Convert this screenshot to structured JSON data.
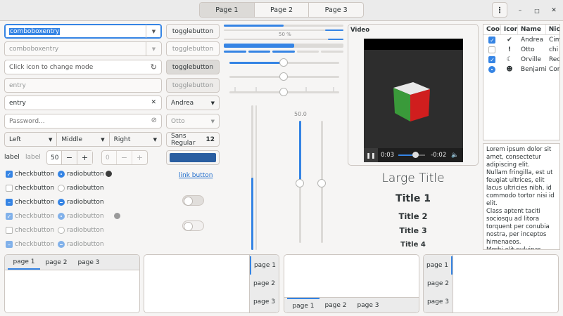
{
  "header": {
    "tabs": [
      "Page 1",
      "Page 2",
      "Page 3"
    ],
    "menu_icon": "⋮",
    "minimize_icon": "–",
    "maximize_icon": "□",
    "close_icon": "✕"
  },
  "col1": {
    "combo1": "comboboxentry",
    "combo2": "comboboxentry",
    "icon_entry": "Click icon to change mode",
    "entry_disabled": "entry",
    "entry_clear": "entry",
    "password_placeholder": "Password...",
    "segmented": [
      "Left",
      "Middle",
      "Right"
    ],
    "label1": "label",
    "label2": "label",
    "spin1": "50",
    "spin2": "0",
    "checks": [
      {
        "label": "checkbutton",
        "state": "on"
      },
      {
        "label": "checkbutton",
        "state": "off"
      },
      {
        "label": "checkbutton",
        "state": "mixed"
      },
      {
        "label": "checkbutton",
        "state": "on"
      },
      {
        "label": "checkbutton",
        "state": "off"
      },
      {
        "label": "checkbutton",
        "state": "mixed"
      }
    ],
    "radios": [
      {
        "label": "radiobutton",
        "state": "on"
      },
      {
        "label": "radiobutton",
        "state": "off"
      },
      {
        "label": "radiobutton",
        "state": "mixed"
      },
      {
        "label": "radiobutton",
        "state": "on"
      },
      {
        "label": "radiobutton",
        "state": "off"
      },
      {
        "label": "radiobutton",
        "state": "mixed"
      }
    ]
  },
  "col2": {
    "toggle1": "togglebutton",
    "toggle2": "togglebutton",
    "toggle3": "togglebutton",
    "toggle4": "togglebutton",
    "combo_andrea": "Andrea",
    "combo_otto": "Otto",
    "font_name": "Sans Regular",
    "font_size": "12",
    "color_swatch": "#2a5ea0",
    "link": "link button"
  },
  "progress": {
    "label": "50 %",
    "value": 0.5
  },
  "vscales": {
    "value_label": "50.0",
    "vprogress": 0.5
  },
  "video": {
    "title": "Video",
    "time_current": "0:03",
    "time_remaining": "-0:02",
    "progress": 0.6
  },
  "titles": {
    "large": "Large Title",
    "t1": "Title 1",
    "t2": "Title 2",
    "t3": "Title 3",
    "t4": "Title 4"
  },
  "tree": {
    "headers": [
      "Cool",
      "Icon",
      "Name",
      "Nic"
    ],
    "rows": [
      {
        "cool": "on",
        "icon": "✔",
        "name": "Andrea",
        "nick": "Cim"
      },
      {
        "cool": "off",
        "icon": "!",
        "name": "Otto",
        "nick": "chi"
      },
      {
        "cool": "on",
        "icon": "☾",
        "name": "Orville",
        "nick": "Red"
      },
      {
        "cool": "radio",
        "icon": "☻",
        "name": "Benjamin",
        "nick": "Con"
      }
    ]
  },
  "textview": {
    "text": "Lorem ipsum dolor sit amet, consectetur adipiscing elit.\nNullam fringilla, est ut feugiat ultrices, elit lacus ultricies nibh, id commodo tortor nisi id elit.\nClass aptent taciti sociosqu ad litora torquent per conubia nostra, per inceptos himenaeos.\nMorbi elit pulvinar..."
  },
  "notebooks": {
    "top": [
      "page 1",
      "page 2",
      "page 3"
    ],
    "right": [
      "page 1",
      "page 2",
      "page 3"
    ],
    "bottom": [
      "page 1",
      "page 2",
      "page 3"
    ],
    "left": [
      "page 1",
      "page 2",
      "page 3"
    ]
  }
}
